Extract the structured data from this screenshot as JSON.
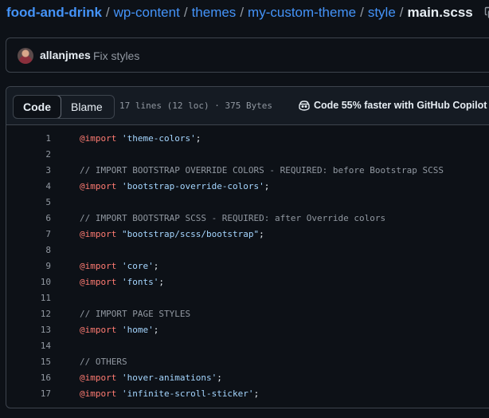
{
  "breadcrumb": {
    "items": [
      "food-and-drink",
      "wp-content",
      "themes",
      "my-custom-theme",
      "style"
    ],
    "separator": "/",
    "current": "main.scss",
    "copy_icon": "copy-icon"
  },
  "commit": {
    "author": "allanjmes",
    "message": "Fix styles"
  },
  "file": {
    "tabs": [
      "Code",
      "Blame"
    ],
    "active_tab": "Code",
    "meta": "17 lines (12 loc) · 375 Bytes",
    "copilot_label": "Code 55% faster with GitHub Copilot",
    "copilot_icon": "copilot-icon"
  },
  "colors": {
    "background": "#0d1117",
    "link": "#4493f8",
    "keyword": "#ff7b72",
    "string": "#a5d6ff",
    "comment": "#9198a1"
  },
  "code_lines": [
    {
      "n": "1",
      "kw": "@import",
      "rest": " ",
      "str": "'theme-colors'",
      "end": ";",
      "comment": ""
    },
    {
      "n": "2",
      "kw": "",
      "rest": "",
      "str": "",
      "end": "",
      "comment": ""
    },
    {
      "n": "3",
      "kw": "",
      "rest": "",
      "str": "",
      "end": "",
      "comment": "// IMPORT BOOTSTRAP OVERRIDE COLORS - REQUIRED: before Bootstrap SCSS"
    },
    {
      "n": "4",
      "kw": "@import",
      "rest": " ",
      "str": "'bootstrap-override-colors'",
      "end": ";",
      "comment": ""
    },
    {
      "n": "5",
      "kw": "",
      "rest": "",
      "str": "",
      "end": "",
      "comment": ""
    },
    {
      "n": "6",
      "kw": "",
      "rest": "",
      "str": "",
      "end": "",
      "comment": "// IMPORT BOOTSTRAP SCSS - REQUIRED: after Override colors"
    },
    {
      "n": "7",
      "kw": "@import",
      "rest": " ",
      "str": "\"bootstrap/scss/bootstrap\"",
      "end": ";",
      "comment": ""
    },
    {
      "n": "8",
      "kw": "",
      "rest": "",
      "str": "",
      "end": "",
      "comment": ""
    },
    {
      "n": "9",
      "kw": "@import",
      "rest": " ",
      "str": "'core'",
      "end": ";",
      "comment": ""
    },
    {
      "n": "10",
      "kw": "@import",
      "rest": " ",
      "str": "'fonts'",
      "end": ";",
      "comment": ""
    },
    {
      "n": "11",
      "kw": "",
      "rest": "",
      "str": "",
      "end": "",
      "comment": ""
    },
    {
      "n": "12",
      "kw": "",
      "rest": "",
      "str": "",
      "end": "",
      "comment": "// IMPORT PAGE STYLES"
    },
    {
      "n": "13",
      "kw": "@import",
      "rest": " ",
      "str": "'home'",
      "end": ";",
      "comment": ""
    },
    {
      "n": "14",
      "kw": "",
      "rest": "",
      "str": "",
      "end": "",
      "comment": ""
    },
    {
      "n": "15",
      "kw": "",
      "rest": "",
      "str": "",
      "end": "",
      "comment": "// OTHERS"
    },
    {
      "n": "16",
      "kw": "@import",
      "rest": " ",
      "str": "'hover-animations'",
      "end": ";",
      "comment": ""
    },
    {
      "n": "17",
      "kw": "@import",
      "rest": " ",
      "str": "'infinite-scroll-sticker'",
      "end": ";",
      "comment": ""
    }
  ]
}
